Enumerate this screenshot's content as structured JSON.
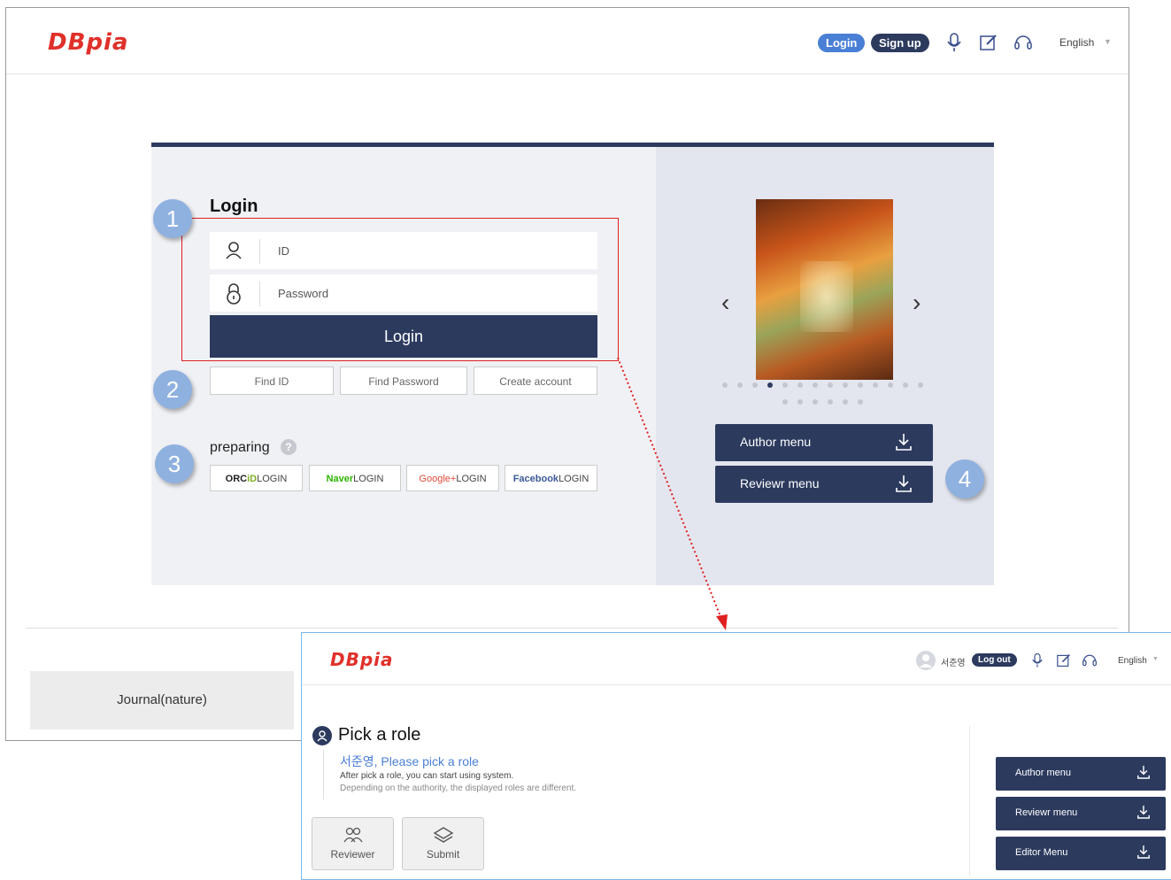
{
  "main_window": {
    "logo": "DBpia",
    "header": {
      "login": "Login",
      "signup": "Sign up",
      "language": "English",
      "icons": [
        "microphone-icon",
        "edit-icon",
        "headset-icon",
        "chevron-down-icon"
      ]
    },
    "login_form": {
      "title": "Login",
      "id_placeholder": "ID",
      "password_placeholder": "Password",
      "login_button": "Login",
      "find_id": "Find ID",
      "find_password": "Find Password",
      "create_account": "Create account",
      "preparing": "preparing",
      "help_glyph": "?"
    },
    "sns": {
      "orcid": {
        "brand_a": "ORC",
        "brand_b": "iD",
        "suffix": "LOGIN"
      },
      "naver": {
        "brand": "Naver",
        "suffix": "LOGIN"
      },
      "google": {
        "brand": "Google+",
        "suffix": "LOGIN"
      },
      "facebook": {
        "brand": "Facebook",
        "suffix": "LOGIN"
      }
    },
    "carousel": {
      "total_slides": 20,
      "active_index": 3
    },
    "right_menu": {
      "author_menu": "Author menu",
      "reviewer_menu": "Reviewr menu"
    },
    "footer": {
      "journal": "Journal(nature)"
    },
    "badges": [
      "1",
      "2",
      "3",
      "4"
    ]
  },
  "second_window": {
    "logo": "DBpia",
    "header": {
      "username": "서준영",
      "logout": "Log out",
      "language": "English"
    },
    "pick_role": {
      "title": "Pick a role",
      "subtitle": "서준영, Please pick a role",
      "desc1": "After pick a role, you can start using system.",
      "desc2": "Depending on the authority, the displayed roles are different."
    },
    "roles": {
      "reviewer": "Reviewer",
      "submit": "Submit"
    },
    "menu": {
      "author_menu": "Author menu",
      "reviewer_menu": "Reviewr menu",
      "editor_menu": "Editor Menu"
    }
  },
  "colors": {
    "navy": "#2c3a5e",
    "brand_red": "#e0302a",
    "login_pill": "#4a7fd6",
    "badge_blue": "#8fb1e0",
    "highlight_red": "#e02020"
  }
}
